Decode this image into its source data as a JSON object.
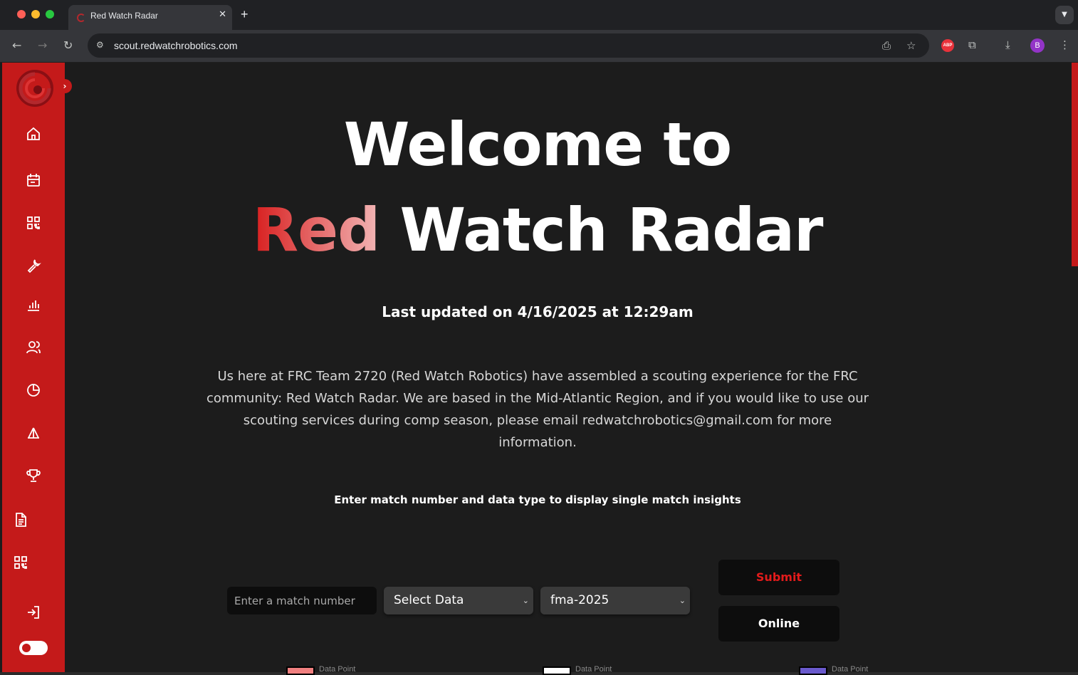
{
  "browser": {
    "tab_title": "Red Watch Radar",
    "tab_close": "✕",
    "new_tab": "+",
    "url": "scout.redwatchrobotics.com",
    "abp_label": "ABP",
    "avatar_letter": "B"
  },
  "sidebar": {
    "items": [
      {
        "icon": "home-icon"
      },
      {
        "icon": "calendar-icon"
      },
      {
        "icon": "qr-code-icon"
      },
      {
        "icon": "wrench-icon"
      },
      {
        "icon": "bar-chart-icon"
      },
      {
        "icon": "users-icon"
      },
      {
        "icon": "pie-chart-icon"
      },
      {
        "icon": "scale-icon"
      },
      {
        "icon": "trophy-icon"
      },
      {
        "icon": "document-icon"
      },
      {
        "icon": "qr-code-icon"
      },
      {
        "icon": "login-icon"
      }
    ],
    "accent_color": "#c41a1a"
  },
  "hero": {
    "line1": "Welcome to",
    "red_word": "Red",
    "rest_word": "Watch Radar",
    "updated": "Last updated on 4/16/2025 at 12:29am",
    "intro": "Us here at FRC Team 2720 (Red Watch Robotics) have assembled a scouting experience for the FRC community: Red Watch Radar. We are based in the Mid-Atlantic Region, and if you would like to use our scouting services during comp season, please email redwatchrobotics@gmail.com for more information."
  },
  "form": {
    "instruction": "Enter match number and data type to display single match insights",
    "match_placeholder": "Enter a match number",
    "data_select": "Select Data",
    "event_select": "fma-2025",
    "submit_label": "Submit",
    "online_label": "Online"
  },
  "legend": [
    {
      "label": "Data Point",
      "color": "#f08080"
    },
    {
      "label": "Data Point",
      "color": "#ffffff"
    },
    {
      "label": "Data Point",
      "color": "#6a5acd"
    }
  ]
}
